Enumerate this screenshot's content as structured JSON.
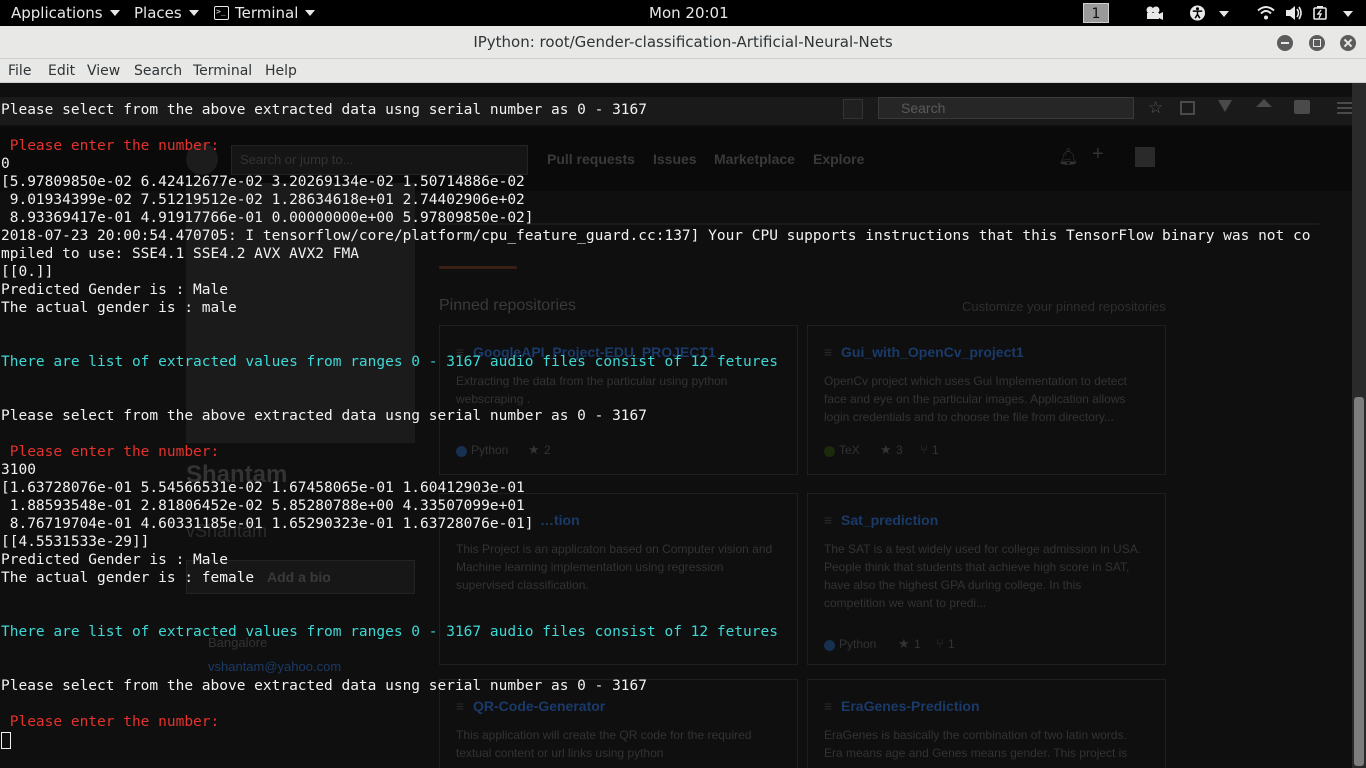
{
  "topbar": {
    "applications": "Applications",
    "places": "Places",
    "terminal": "Terminal",
    "clock": "Mon 20:01",
    "workspace": "1",
    "icons": [
      "video-icon",
      "accessibility-icon",
      "wifi-icon",
      "volume-icon",
      "battery-icon"
    ]
  },
  "window": {
    "title": "IPython: root/Gender-classification-Artificial-Neural-Nets",
    "controls": [
      "minimize",
      "maximize",
      "close"
    ]
  },
  "menubar": [
    "File",
    "Edit",
    "View",
    "Search",
    "Terminal",
    "Help"
  ],
  "terminal_lines": [
    {
      "text": "Please select from the above extracted data usng serial number as 0 - 3167",
      "style": ""
    },
    {
      "text": "",
      "style": ""
    },
    {
      "text": " Please enter the number:",
      "style": "red"
    },
    {
      "text": "0",
      "style": ""
    },
    {
      "text": "[5.97809850e-02 6.42412677e-02 3.20269134e-02 1.50714886e-02",
      "style": ""
    },
    {
      "text": " 9.01934399e-02 7.51219512e-02 1.28634618e+01 2.74402906e+02",
      "style": ""
    },
    {
      "text": " 8.93369417e-01 4.91917766e-01 0.00000000e+00 5.97809850e-02]",
      "style": ""
    },
    {
      "text": "2018-07-23 20:00:54.470705: I tensorflow/core/platform/cpu_feature_guard.cc:137] Your CPU supports instructions that this TensorFlow binary was not co",
      "style": ""
    },
    {
      "text": "mpiled to use: SSE4.1 SSE4.2 AVX AVX2 FMA",
      "style": ""
    },
    {
      "text": "[[0.]]",
      "style": ""
    },
    {
      "text": "Predicted Gender is : Male",
      "style": ""
    },
    {
      "text": "The actual gender is : male",
      "style": ""
    },
    {
      "text": "",
      "style": ""
    },
    {
      "text": "",
      "style": ""
    },
    {
      "text": "There are list of extracted values from ranges 0 - 3167 audio files consist of 12 fetures",
      "style": "cyan"
    },
    {
      "text": "",
      "style": ""
    },
    {
      "text": "",
      "style": ""
    },
    {
      "text": "Please select from the above extracted data usng serial number as 0 - 3167",
      "style": ""
    },
    {
      "text": "",
      "style": ""
    },
    {
      "text": " Please enter the number:",
      "style": "red"
    },
    {
      "text": "3100",
      "style": ""
    },
    {
      "text": "[1.63728076e-01 5.54566531e-02 1.67458065e-01 1.60412903e-01",
      "style": ""
    },
    {
      "text": " 1.88593548e-01 2.81806452e-02 5.85280788e+00 4.33507099e+01",
      "style": ""
    },
    {
      "text": " 8.76719704e-01 4.60331185e-01 1.65290323e-01 1.63728076e-01]",
      "style": ""
    },
    {
      "text": "[[4.5531533e-29]]",
      "style": ""
    },
    {
      "text": "Predicted Gender is : Male",
      "style": ""
    },
    {
      "text": "The actual gender is : female",
      "style": ""
    },
    {
      "text": "",
      "style": ""
    },
    {
      "text": "",
      "style": ""
    },
    {
      "text": "There are list of extracted values from ranges 0 - 3167 audio files consist of 12 fetures",
      "style": "cyan"
    },
    {
      "text": "",
      "style": ""
    },
    {
      "text": "",
      "style": ""
    },
    {
      "text": "Please select from the above extracted data usng serial number as 0 - 3167",
      "style": ""
    },
    {
      "text": "",
      "style": ""
    },
    {
      "text": " Please enter the number:",
      "style": "red"
    },
    {
      "text": "",
      "style": "cursor"
    }
  ],
  "background_browser": {
    "search_placeholder": "Search",
    "jump_placeholder": "Search or jump to...",
    "nav": [
      "Pull requests",
      "Issues",
      "Marketplace",
      "Explore"
    ],
    "pinned_title": "Pinned repositories",
    "customize": "Customize your pinned repositories",
    "profile_name": "Shantam",
    "profile_user": "vShantam",
    "add_bio": "Add a bio",
    "location": "Bangalore",
    "email": "vshantam@yahoo.com",
    "repos": [
      {
        "name": "GoogleAPI_Project-EDU_PROJECT1",
        "desc": [
          "Extracting the data from the particular using python",
          "webscraping ."
        ],
        "lang": "Python",
        "lang_color": "#3572A5",
        "stars": "2",
        "forks": ""
      },
      {
        "name": "Gui_with_OpenCv_project1",
        "desc": [
          "OpenCv project which uses Gui Implementation to detect",
          "face and eye on the particular images. Application allows",
          "login credentials and to choose the file from directory..."
        ],
        "lang": "TeX",
        "lang_color": "#3D6117",
        "stars": "3",
        "forks": "1"
      },
      {
        "name": "…tion",
        "desc": [
          "This Project is an applicaton based on Computer vision and",
          "Machine learning implementation using regression",
          "supervised classification."
        ],
        "lang": "",
        "lang_color": "",
        "stars": "",
        "forks": ""
      },
      {
        "name": "Sat_prediction",
        "desc": [
          "The SAT is a test widely used for college admission in USA.",
          "People think that students that achieve high score in SAT,",
          "have also the highest GPA during college. In this",
          "competition we want to predi..."
        ],
        "lang": "Python",
        "lang_color": "#3572A5",
        "stars": "1",
        "forks": "1"
      },
      {
        "name": "QR-Code-Generator",
        "desc": [
          "This application will create the QR code for the required",
          "textual content or url links using python"
        ],
        "lang": "",
        "lang_color": "",
        "stars": "",
        "forks": ""
      },
      {
        "name": "EraGenes-Prediction",
        "desc": [
          "EraGenes is basically the combination of two latin words.",
          "Era means age and Genes means gender. This project is"
        ],
        "lang": "",
        "lang_color": "",
        "stars": "",
        "forks": ""
      }
    ]
  }
}
